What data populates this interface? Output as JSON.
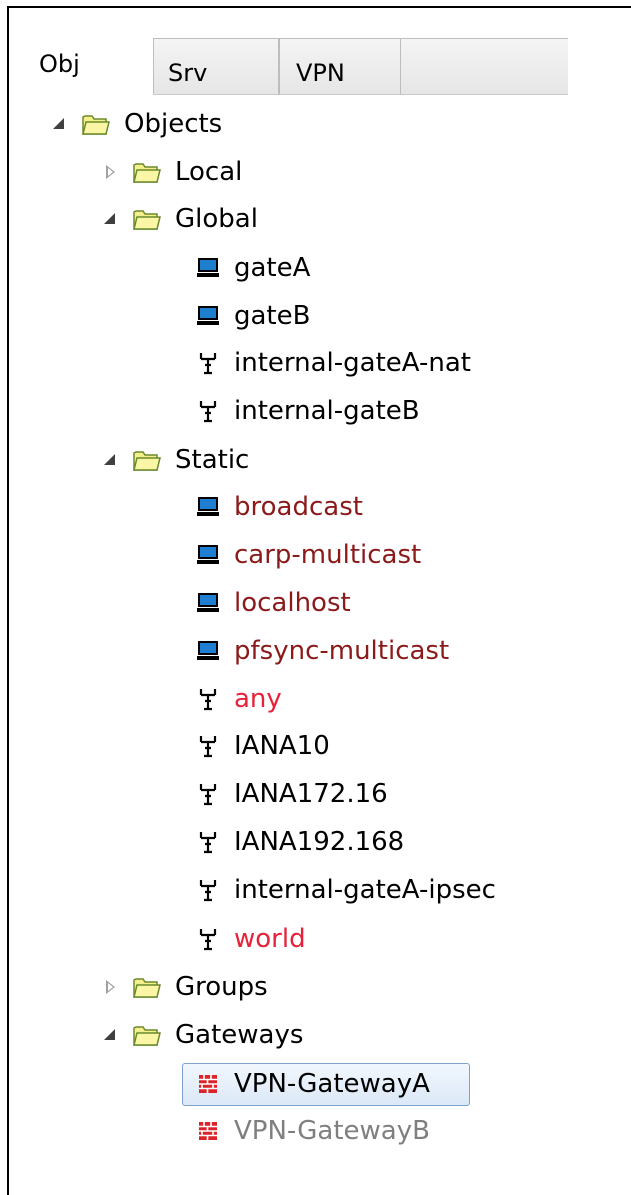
{
  "tabs": [
    {
      "label": "Obj",
      "active": true
    },
    {
      "label": "Srv",
      "active": false
    },
    {
      "label": "VPN",
      "active": false
    }
  ],
  "tree": {
    "root": {
      "label": "Objects",
      "expanded": true
    },
    "local": {
      "label": "Local",
      "expanded": false
    },
    "global": {
      "label": "Global",
      "expanded": true,
      "items": [
        {
          "label": "gateA",
          "icon": "host-icon"
        },
        {
          "label": "gateB",
          "icon": "host-icon"
        },
        {
          "label": "internal-gateA-nat",
          "icon": "network-icon"
        },
        {
          "label": "internal-gateB",
          "icon": "network-icon"
        }
      ]
    },
    "static": {
      "label": "Static",
      "expanded": true,
      "items": [
        {
          "label": "broadcast",
          "icon": "host-icon",
          "color": "#8b1a1a"
        },
        {
          "label": "carp-multicast",
          "icon": "host-icon",
          "color": "#8b1a1a"
        },
        {
          "label": "localhost",
          "icon": "host-icon",
          "color": "#8b1a1a"
        },
        {
          "label": "pfsync-multicast",
          "icon": "host-icon",
          "color": "#8b1a1a"
        },
        {
          "label": "any",
          "icon": "network-icon",
          "color": "#e8203a"
        },
        {
          "label": "IANA10",
          "icon": "network-icon",
          "color": "#000000"
        },
        {
          "label": "IANA172.16",
          "icon": "network-icon",
          "color": "#000000"
        },
        {
          "label": "IANA192.168",
          "icon": "network-icon",
          "color": "#000000"
        },
        {
          "label": "internal-gateA-ipsec",
          "icon": "network-icon",
          "color": "#000000"
        },
        {
          "label": "world",
          "icon": "network-icon",
          "color": "#e8203a"
        }
      ]
    },
    "groups": {
      "label": "Groups",
      "expanded": false
    },
    "gateways": {
      "label": "Gateways",
      "expanded": true,
      "items": [
        {
          "label": "VPN-GatewayA",
          "icon": "gateway-icon",
          "selected": true
        },
        {
          "label": "VPN-GatewayB",
          "icon": "gateway-icon",
          "selected": false,
          "color": "#7f7f7f"
        }
      ]
    }
  },
  "colors": {
    "folder_fill": "#f6f08a",
    "folder_border": "#6a8a2a",
    "host_screen": "#1e7fd0",
    "gateway_red": "#d9242a",
    "selection_border": "#7da2ce"
  }
}
